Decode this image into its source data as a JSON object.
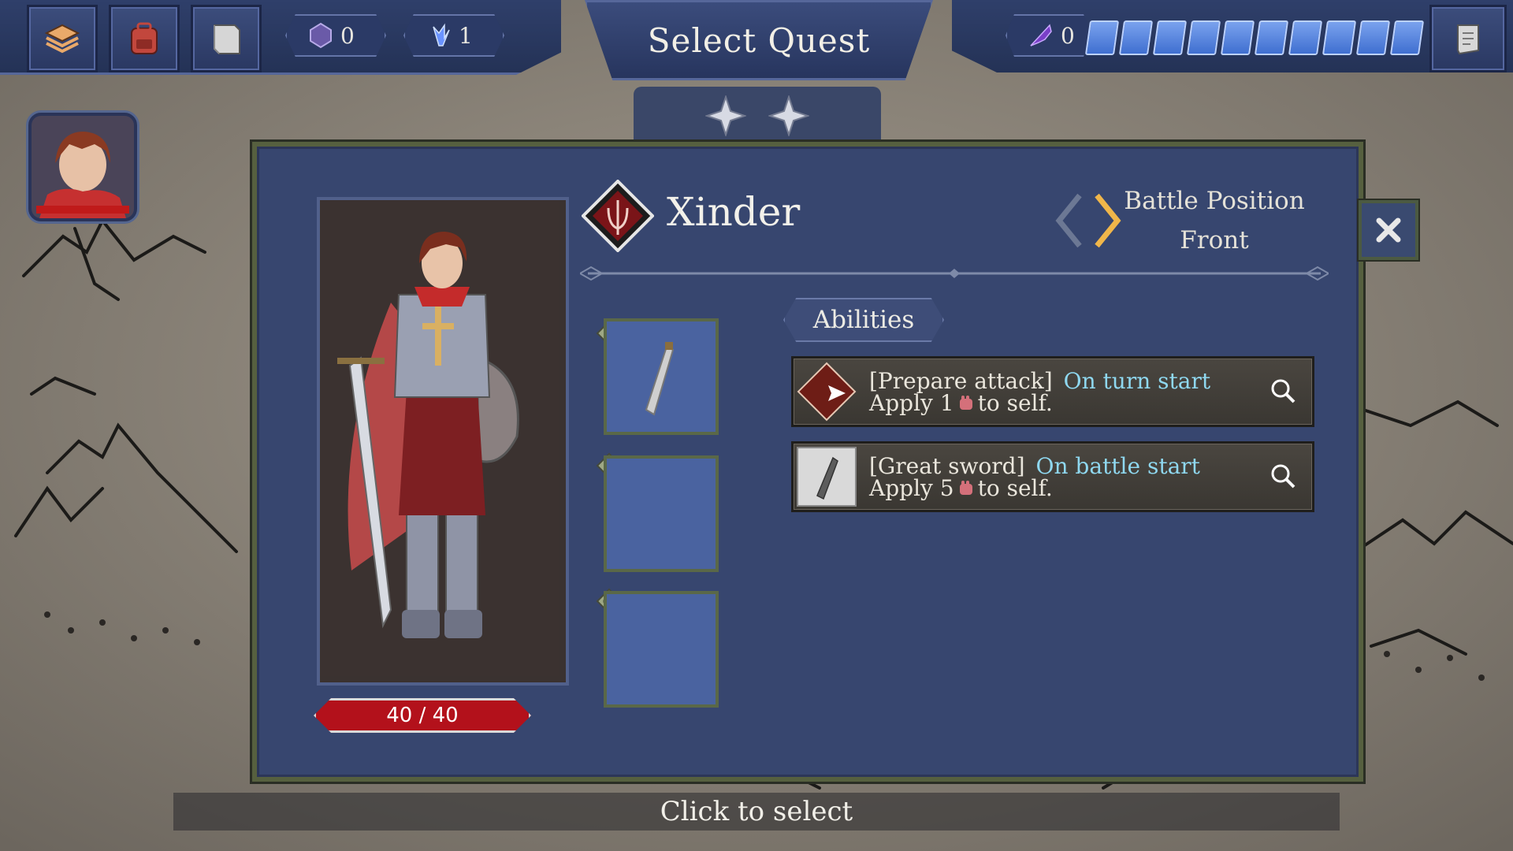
{
  "header": {
    "title": "Select Quest",
    "resources": [
      {
        "name": "shard-resource",
        "icon": "purple-shard-icon",
        "value": "0"
      },
      {
        "name": "crystal-resource",
        "icon": "blue-crystal-icon",
        "value": "1"
      }
    ],
    "energy": {
      "icon": "purple-feather-icon",
      "value": "0",
      "pips_filled": 10,
      "pips_total": 10
    },
    "toolbar_icons": [
      "stack-icon",
      "backpack-icon",
      "book-icon"
    ],
    "menu_icon": "scroll-icon"
  },
  "character": {
    "name": "Xinder",
    "hp": "40 / 40",
    "battle_position_label": "Battle Position",
    "battle_position_value": "Front",
    "stars": 2
  },
  "abilities": {
    "label": "Abilities",
    "items": [
      {
        "name": "[Prepare attack]",
        "trigger": "On turn start",
        "effect_prefix": "Apply 1",
        "effect_suffix": "to self.",
        "icon": "arrow-slash-icon"
      },
      {
        "name": "[Great sword]",
        "trigger": "On battle start",
        "effect_prefix": "Apply 5",
        "effect_suffix": "to self.",
        "icon": "great-sword-icon"
      }
    ]
  },
  "equipment_slots": [
    {
      "slot": "weapon",
      "item_icon": "great-sword-icon"
    },
    {
      "slot": "armor",
      "item_icon": ""
    },
    {
      "slot": "ring",
      "item_icon": ""
    }
  ],
  "footer": {
    "hint": "Click to select"
  },
  "colors": {
    "panel": "#37466f",
    "accent_trigger": "#8fd8f0",
    "hp_red": "#b3111b"
  }
}
